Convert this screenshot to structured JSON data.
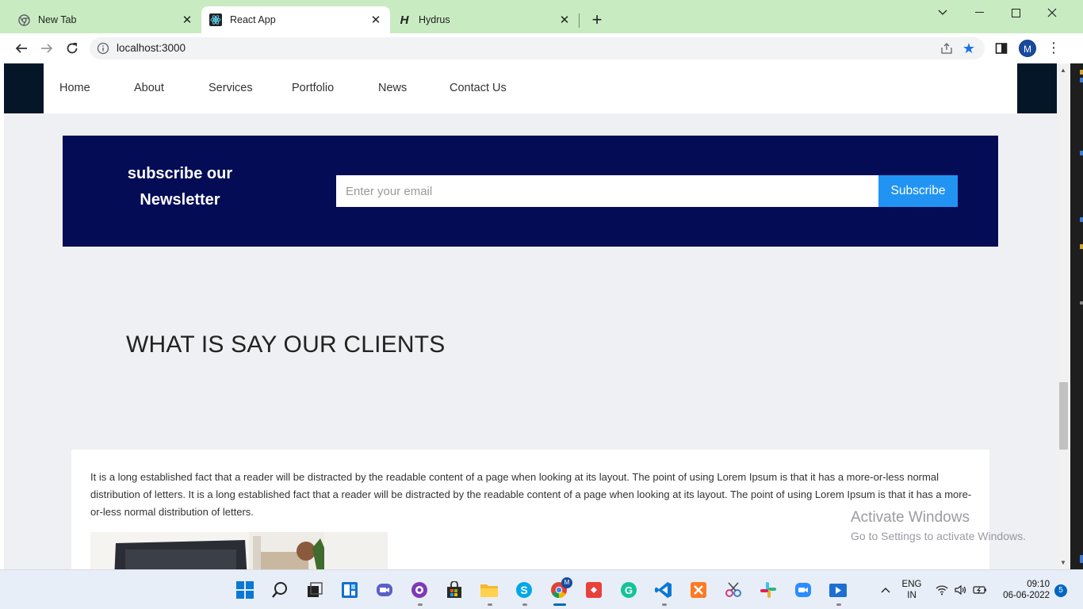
{
  "browser": {
    "tabs": [
      {
        "title": "New Tab",
        "icon": "chrome-icon"
      },
      {
        "title": "React App",
        "icon": "react-icon",
        "active": true
      },
      {
        "title": "Hydrus",
        "icon": "hydrus-icon"
      }
    ],
    "url": "localhost:3000",
    "profile_initial": "M"
  },
  "nav": {
    "links": [
      "Home",
      "About",
      "Services",
      "Portfolio",
      "News",
      "Contact Us"
    ]
  },
  "newsletter": {
    "title_line1": "subscribe our",
    "title_line2": "Newsletter",
    "email_placeholder": "Enter your email",
    "button_label": "Subscribe"
  },
  "clients": {
    "heading": "WHAT IS SAY OUR CLIENTS",
    "testimonial_text": "It is a long established fact that a reader will be distracted by the readable content of a page when looking at its layout. The point of using Lorem Ipsum is that it has a more-or-less normal distribution of letters. It is a long established fact that a reader will be distracted by the readable content of a page when looking at its layout. The point of using Lorem Ipsum is that it has a more-or-less normal distribution of letters."
  },
  "watermark": {
    "line1": "Activate Windows",
    "line2": "Go to Settings to activate Windows."
  },
  "taskbar": {
    "language_line1": "ENG",
    "language_line2": "IN",
    "time": "09:10",
    "date": "06-06-2022",
    "notification_count": "5",
    "chrome_badge": "M"
  },
  "colors": {
    "tabbar": "#c9ebc1",
    "newsletter_bg": "#030c55",
    "subscribe_button": "#2193f3",
    "nav_dark": "#051629"
  }
}
